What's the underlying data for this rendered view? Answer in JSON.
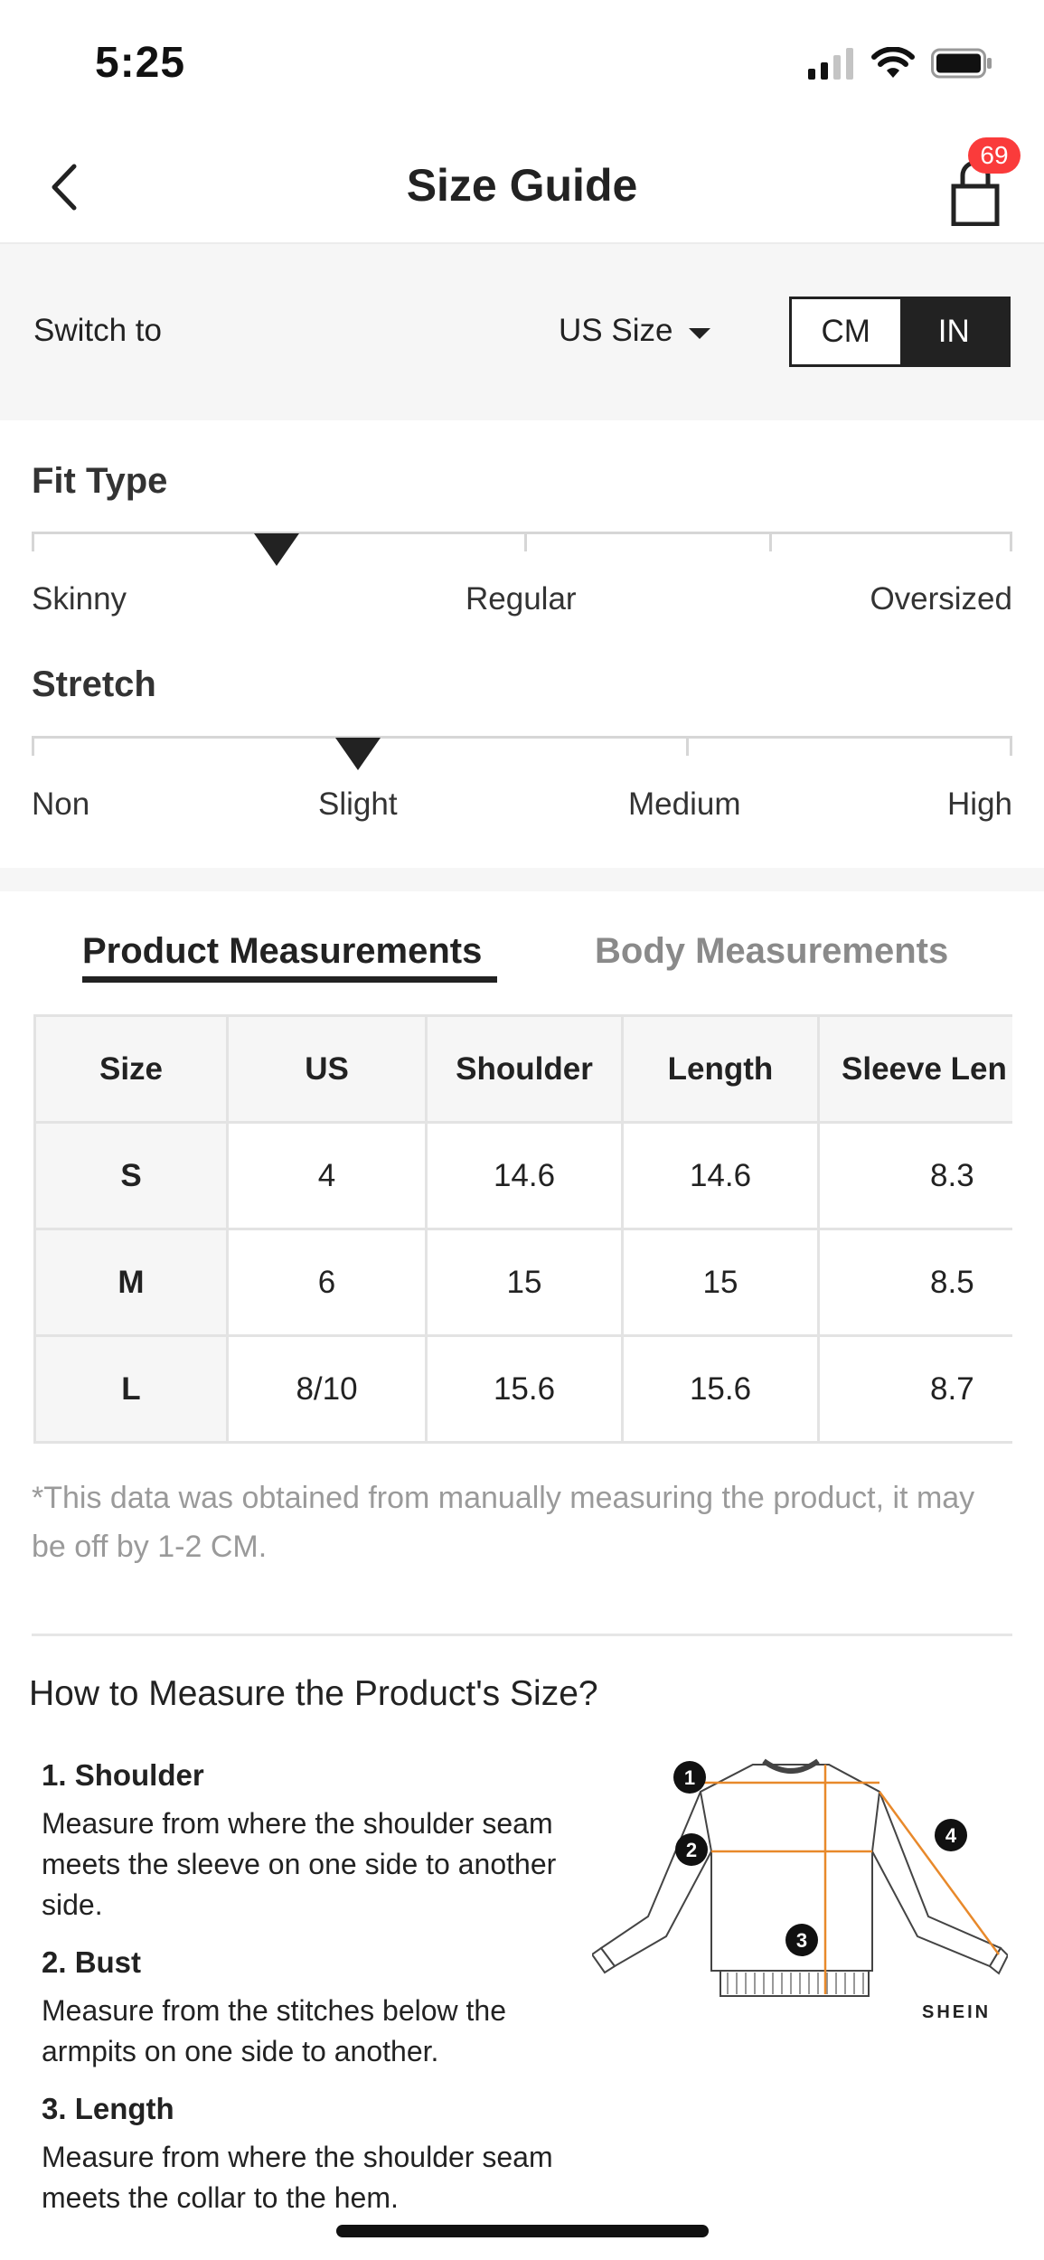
{
  "status_bar": {
    "time": "5:25"
  },
  "nav": {
    "title": "Size Guide",
    "cart_badge": "69"
  },
  "switch_bar": {
    "label": "Switch to",
    "size_system": "US Size",
    "units": [
      "CM",
      "IN"
    ],
    "selected_unit": "IN"
  },
  "fit_type": {
    "title": "Fit Type",
    "labels": [
      "Skinny",
      "Regular",
      "Oversized"
    ],
    "level": 0.25
  },
  "stretch": {
    "title": "Stretch",
    "labels": [
      "Non",
      "Slight",
      "Medium",
      "High"
    ],
    "level": 0.333
  },
  "tabs": {
    "active": "Product Measurements",
    "inactive": "Body Measurements"
  },
  "table": {
    "headers": [
      "Size",
      "US",
      "Shoulder",
      "Length",
      "Sleeve Len"
    ],
    "rows": [
      [
        "S",
        "4",
        "14.6",
        "14.6",
        "8.3"
      ],
      [
        "M",
        "6",
        "15",
        "15",
        "8.5"
      ],
      [
        "L",
        "8/10",
        "15.6",
        "15.6",
        "8.7"
      ]
    ]
  },
  "note": "*This data was obtained from manually measuring the product, it may be off by 1-2 CM.",
  "howto": {
    "title": "How to Measure the Product's Size?",
    "items": [
      {
        "title": "1. Shoulder",
        "desc": "Measure from where the shoulder seam meets the sleeve on one side to another side."
      },
      {
        "title": "2. Bust",
        "desc": "Measure from the stitches below the armpits on one side to another."
      },
      {
        "title": "3. Length",
        "desc": "Measure from where the shoulder seam meets the collar to the hem."
      }
    ],
    "diagram_markers": [
      "1",
      "2",
      "3",
      "4"
    ],
    "brand": "SHEIN"
  },
  "colors": {
    "accent": "#222222",
    "badge": "#fa3b3b",
    "measure_line": "#e8892b"
  }
}
